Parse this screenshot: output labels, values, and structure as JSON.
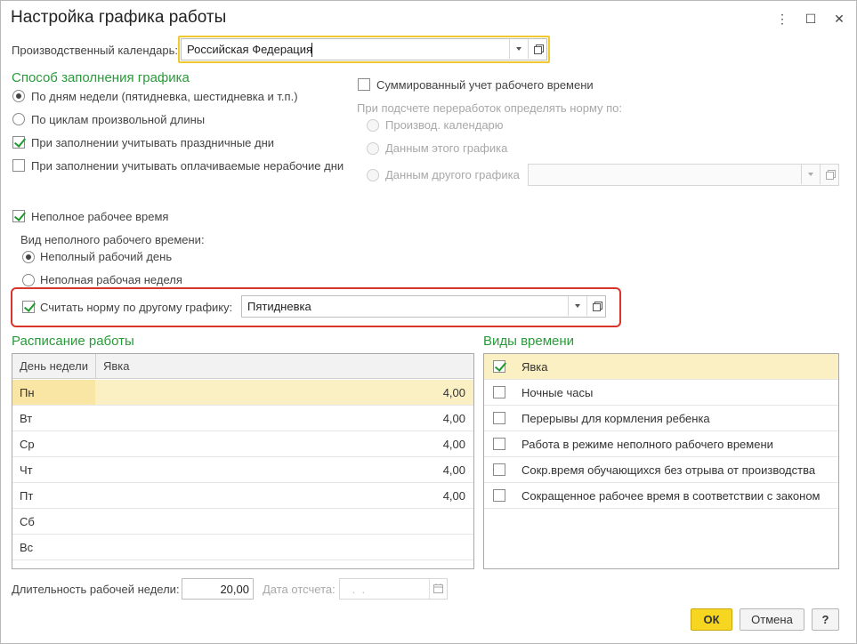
{
  "window": {
    "title": "Настройка графика работы",
    "controls": {
      "menu": "⋮",
      "maximize": "☐",
      "close": "✕"
    }
  },
  "calendar": {
    "label": "Производственный календарь:",
    "value": "Российская Федерация"
  },
  "fill_method": {
    "title": "Способ заполнения графика",
    "option_weekdays": "По дням недели (пятидневка, шестидневка и т.п.)",
    "option_cycles": "По циклам произвольной длины",
    "check_holidays": "При заполнении учитывать праздничные дни",
    "check_paid_nonworking": "При заполнении учитывать оплачиваемые нерабочие дни"
  },
  "summary": {
    "check_label": "Суммированный учет рабочего времени",
    "norm_label": "При подсчете переработок определять норму по:",
    "option_calendar": "Производ. календарю",
    "option_this": "Данным этого графика",
    "option_other": "Данным другого графика"
  },
  "part_time": {
    "check_label": "Неполное рабочее время",
    "kind_label": "Вид неполного рабочего времени:",
    "option_day": "Неполный рабочий день",
    "option_week": "Неполная рабочая неделя",
    "norm_check_label": "Считать норму по другому графику:",
    "norm_value": "Пятидневка"
  },
  "schedule": {
    "title": "Расписание работы",
    "col_day": "День недели",
    "col_presence": "Явка",
    "rows": [
      {
        "day": "Пн",
        "value": "4,00"
      },
      {
        "day": "Вт",
        "value": "4,00"
      },
      {
        "day": "Ср",
        "value": "4,00"
      },
      {
        "day": "Чт",
        "value": "4,00"
      },
      {
        "day": "Пт",
        "value": "4,00"
      },
      {
        "day": "Сб",
        "value": ""
      },
      {
        "day": "Вс",
        "value": ""
      }
    ]
  },
  "time_types": {
    "title": "Виды времени",
    "items": [
      {
        "label": "Явка",
        "checked": true
      },
      {
        "label": "Ночные часы",
        "checked": false
      },
      {
        "label": "Перерывы для кормления ребенка",
        "checked": false
      },
      {
        "label": "Работа в режиме неполного рабочего времени",
        "checked": false
      },
      {
        "label": "Сокр.время обучающихся без отрыва от производства",
        "checked": false
      },
      {
        "label": "Сокращенное рабочее время в соответствии с законом",
        "checked": false
      }
    ]
  },
  "footer": {
    "week_length_label": "Длительность рабочей недели:",
    "week_length_value": "20,00",
    "ref_date_label": "Дата отсчета:",
    "ref_date_value": " .  ."
  },
  "buttons": {
    "ok": "ОК",
    "cancel": "Отмена",
    "help": "?"
  },
  "colors": {
    "section": "#2a9a3a",
    "highlight": "#d9342b",
    "ok_button": "#f7d622",
    "selection": "#fbefc4"
  }
}
